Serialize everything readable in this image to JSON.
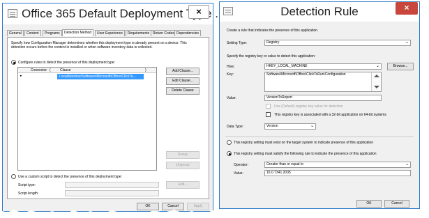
{
  "left_window": {
    "title": "Office 365 Default Deployment Type ...",
    "close": "×",
    "tabs": [
      "General",
      "Content",
      "Programs",
      "Detection Method",
      "User Experience",
      "Requirements",
      "Return Codes",
      "Dependencies"
    ],
    "description": "Specify how Configuration Manager determines whether this deployment type is already present on a device. This detection occurs before the content is installed or when software inventory data is collected.",
    "radio_rules_label": "Configure rules to detect the presence of this deployment type:",
    "table": {
      "headers": [
        "Connector",
        "(",
        "Clause",
        ")"
      ],
      "row": {
        "marker": "▸",
        "clause": "LocalMachine\\Software\\Microsoft\\Office\\ClickTo..."
      }
    },
    "buttons": {
      "add": "Add Clause...",
      "edit": "Edit Clause...",
      "delete": "Delete Clause",
      "group": "Group",
      "ungroup": "Ungroup",
      "edit_script": "Edit..."
    },
    "radio_script_label": "Use a custom script to detect the presence of this deployment type:",
    "script_type_label": "Script type:",
    "script_length_label": "Script length:",
    "footer": {
      "ok": "OK",
      "cancel": "Cancel",
      "apply": "Apply"
    }
  },
  "right_window": {
    "title": "Detection Rule",
    "close": "×",
    "intro": "Create a rule that indicates the presence of this application.",
    "setting_type_label": "Setting Type:",
    "setting_type_value": "Registry",
    "specify_label": "Specify the registry key or value to detect this application:",
    "hive_label": "Hive:",
    "hive_value": "HKEY_LOCAL_MACHINE",
    "browse": "Browse...",
    "key_label": "Key:",
    "key_value": "Software\\Microsoft\\Office\\ClickToRun\\Configuration",
    "value_label": "Value:",
    "value_value": "VersionToReport",
    "default_value_label": "Use (Default) registry key value for detection",
    "bit32_label": "This registry key is associated with a 32-bit application on 64-bit systems",
    "data_type_label": "Data Type:",
    "data_type_value": "Version",
    "radio_exist_label": "This registry setting must exist on the target system to indicate presence of this application",
    "radio_satisfy_label": "This registry setting must satisfy the following rule to indicate the presence of this application",
    "operator_label": "Operator:",
    "operator_value": "Greater than or equal to",
    "rule_value_label": "Value:",
    "rule_value": "16.0.7341.2035",
    "footer": {
      "ok": "OK",
      "cancel": "Cancel"
    }
  }
}
